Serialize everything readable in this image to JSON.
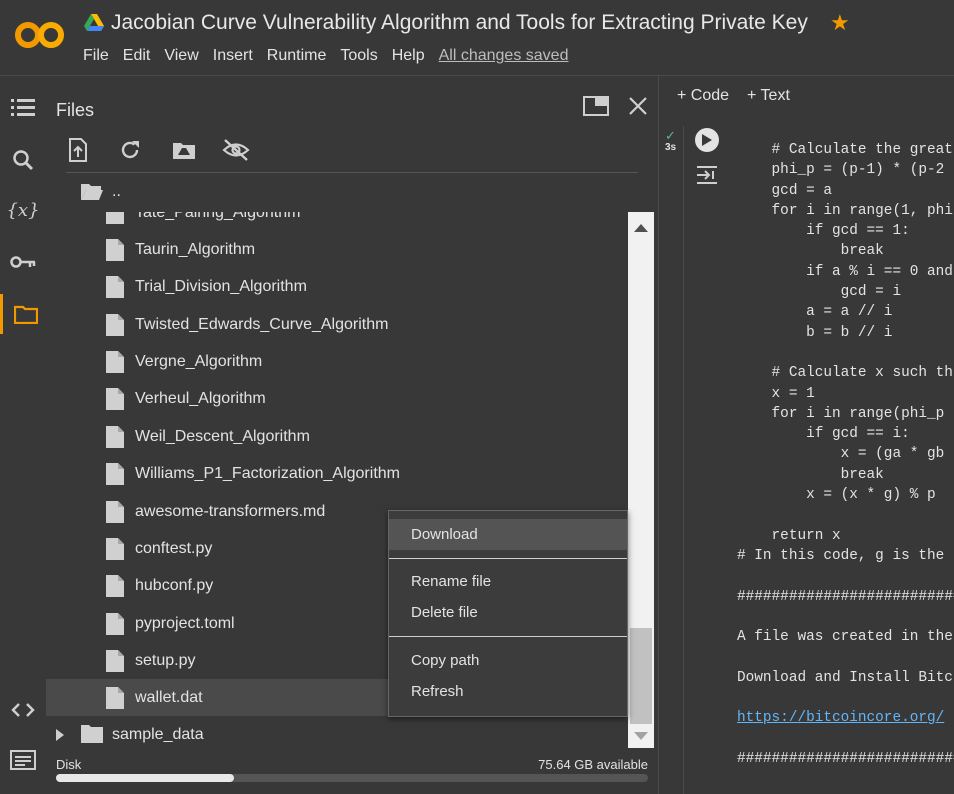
{
  "app": {
    "title": "Jacobian Curve Vulnerability Algorithm and Tools for Extracting Private Key",
    "logo_text": "CO",
    "brand_color": "#f29900",
    "menu": [
      "File",
      "Edit",
      "View",
      "Insert",
      "Runtime",
      "Tools",
      "Help"
    ],
    "save_status": "All changes saved"
  },
  "rail": {
    "icons": [
      "toc-icon",
      "search-icon",
      "variables-icon",
      "key-icon",
      "folder-icon",
      "code-snippets-icon",
      "terminal-icon"
    ],
    "variables_glyph": "{x}"
  },
  "files": {
    "title": "Files",
    "updir": "..",
    "items": [
      "Tate_Pairing_Algorithm",
      "Taurin_Algorithm",
      "Trial_Division_Algorithm",
      "Twisted_Edwards_Curve_Algorithm",
      "Vergne_Algorithm",
      "Verheul_Algorithm",
      "Weil_Descent_Algorithm",
      "Williams_P1_Factorization_Algorithm",
      "awesome-transformers.md",
      "conftest.py",
      "hubconf.py",
      "pyproject.toml",
      "setup.py",
      "wallet.dat"
    ],
    "folder": "sample_data",
    "disk_label": "Disk",
    "disk_available": "75.64 GB available",
    "disk_used_fraction": 0.3
  },
  "context_menu": {
    "items": [
      "Download",
      "Rename file",
      "Delete file",
      "Copy path",
      "Refresh"
    ]
  },
  "notebook": {
    "add_code": "+ Code",
    "add_text": "+ Text",
    "exec_time": "3s",
    "code_lines": [
      "    # Calculate the great",
      "    phi_p = (p-1) * (p-2",
      "    gcd = a",
      "    for i in range(1, phi",
      "        if gcd == 1:",
      "            break",
      "        if a % i == 0 and",
      "            gcd = i",
      "        a = a // i",
      "        b = b // i",
      "",
      "    # Calculate x such th",
      "    x = 1",
      "    for i in range(phi_p",
      "        if gcd == i:",
      "            x = (ga * gb",
      "            break",
      "        x = (x * g) % p",
      "",
      "    return x",
      "# In this code, g is the",
      "",
      "##########################",
      "",
      "A file was created in the",
      "",
      "Download and Install Bitc",
      "",
      "https://bitcoincore.org/",
      "",
      "##########################"
    ]
  }
}
